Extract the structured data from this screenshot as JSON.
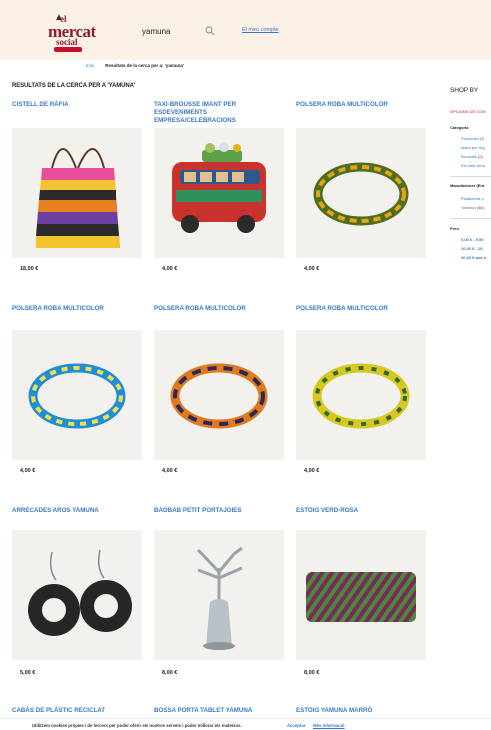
{
  "header": {
    "logo_top": "el",
    "logo_main": "mercat",
    "logo_bottom": "social",
    "search_value": "yamuna",
    "account_link": "El meu compte"
  },
  "breadcrumb": {
    "home": "Inici",
    "current": "Resultats de la cerca per a: 'yamuna'"
  },
  "results_title": "RESULTATS DE LA CERCA PER A 'YAMUNA'",
  "products": [
    {
      "title": "CISTELL DE RÀFIA",
      "price": "18,00 €",
      "icon": "raffia-basket"
    },
    {
      "title": "TAXI-BROUSSE IMANT PER ESDEVENIMENTS EMPRESA/CELEBRACIONS",
      "price": "4,00 €",
      "icon": "bus-magnet"
    },
    {
      "title": "POLSERA ROBA MULTICOLOR",
      "price": "4,00 €",
      "icon": "bracelet-green"
    },
    {
      "title": "POLSERA ROBA MULTICOLOR",
      "price": "4,00 €",
      "icon": "bracelet-blue"
    },
    {
      "title": "POLSERA ROBA MULTICOLOR",
      "price": "4,00 €",
      "icon": "bracelet-orange"
    },
    {
      "title": "POLSERA ROBA MULTICOLOR",
      "price": "4,00 €",
      "icon": "bracelet-yellow"
    },
    {
      "title": "ARRECADES AROS YAMUNA",
      "price": "5,00 €",
      "icon": "earrings"
    },
    {
      "title": "BAOBAB PETIT PORTAJOIES",
      "price": "8,00 €",
      "icon": "baobab-jewel-holder"
    },
    {
      "title": "ESTOIG VERD-ROSA",
      "price": "8,00 €",
      "icon": "pouch"
    },
    {
      "title": "CABÀS DE PLÀSTIC RECICLAT",
      "price": "",
      "icon": ""
    },
    {
      "title": "BOSSA PORTA TABLET YAMUNA",
      "price": "",
      "icon": ""
    },
    {
      "title": "ESTOIG YAMUNA MARRÓ",
      "price": "",
      "icon": ""
    }
  ],
  "sidebar": {
    "title": "SHOP BY",
    "options_label": "OPCIONS DE COM",
    "category_heading": "Categoria",
    "categories": [
      {
        "label": "Productes",
        "count": "(9"
      },
      {
        "label": "Idees per reg",
        "count": ""
      },
      {
        "label": "Novetats",
        "count": "(2)"
      },
      {
        "label": "Els més venu",
        "count": ""
      }
    ],
    "manufacturer_heading": "Manufacturer (Ent",
    "manufacturers": [
      {
        "label": "Plataforma p",
        "count": ""
      },
      {
        "label": "Yamuna",
        "count": "(48)"
      }
    ],
    "price_heading": "Preu",
    "prices": [
      "0,00 € - 9,99",
      "10,00 € - 19,",
      "20,00 € and a"
    ]
  },
  "cookie": {
    "text": "Utilitzem cookies pròpies i de tercers per poder oferir els nostres serveis i poder millorar els mateixos.",
    "accept": "Acceptar",
    "more": "Més informació"
  },
  "colors": {
    "link": "#3a78c3",
    "brand": "#8a1f2e",
    "accent_red": "#c8102e",
    "header_bg": "#fbf1e6"
  }
}
